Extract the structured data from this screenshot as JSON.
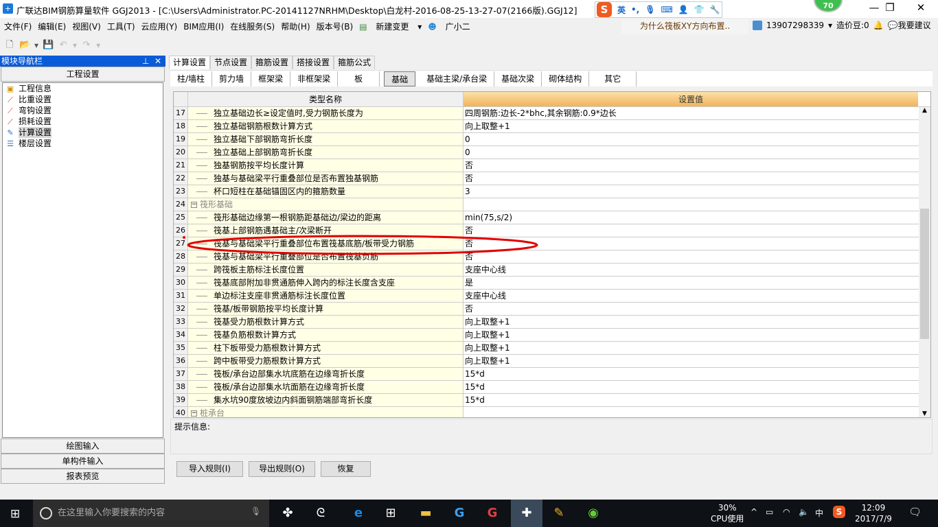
{
  "window": {
    "title": "广联达BIM钢筋算量软件 GGJ2013 - [C:\\Users\\Administrator.PC-20141127NRHM\\Desktop\\白龙村-2016-08-25-13-27-07(2166版).GGJ12]",
    "badge": "70",
    "ime_lang": "英"
  },
  "menu": [
    "文件(F)",
    "编辑(E)",
    "视图(V)",
    "工具(T)",
    "云应用(Y)",
    "BIM应用(I)",
    "在线服务(S)",
    "帮助(H)",
    "版本号(B)",
    "新建变更",
    "广小二"
  ],
  "header": {
    "question": "为什么筏板XY方向布置..",
    "user": "13907298339",
    "beans": "造价豆:0",
    "suggest": "我要建议"
  },
  "left_panel": {
    "title": "模块导航栏",
    "section": "工程设置",
    "tree": [
      "工程信息",
      "比重设置",
      "弯钩设置",
      "损耗设置",
      "计算设置",
      "楼层设置"
    ],
    "selected": "计算设置",
    "bottom": [
      "绘图输入",
      "单构件输入",
      "报表预览"
    ]
  },
  "tabs": [
    "计算设置",
    "节点设置",
    "箍筋设置",
    "搭接设置",
    "箍筋公式"
  ],
  "active_tab": "计算设置",
  "subtabs": [
    "柱/墙柱",
    "剪力墙",
    "框架梁",
    "非框架梁",
    "板",
    "基础",
    "基础主梁/承台梁",
    "基础次梁",
    "砌体结构",
    "其它"
  ],
  "active_subtab": "基础",
  "grid": {
    "col_name": "类型名称",
    "col_value": "设置值",
    "rows": [
      {
        "n": "17",
        "name": "独立基础边长≥设定值时,受力钢筋长度为",
        "value": "四周钢筋:边长-2*bhc,其余钢筋:0.9*边长"
      },
      {
        "n": "18",
        "name": "独立基础钢筋根数计算方式",
        "value": "向上取整+1"
      },
      {
        "n": "19",
        "name": "独立基础下部钢筋弯折长度",
        "value": "0"
      },
      {
        "n": "20",
        "name": "独立基础上部钢筋弯折长度",
        "value": "0"
      },
      {
        "n": "21",
        "name": "独基钢筋按平均长度计算",
        "value": "否"
      },
      {
        "n": "22",
        "name": "独基与基础梁平行重叠部位是否布置独基钢筋",
        "value": "否"
      },
      {
        "n": "23",
        "name": "杯口短柱在基础锚固区内的箍筋数量",
        "value": "3"
      },
      {
        "n": "24",
        "name": "筏形基础",
        "value": "",
        "group": true
      },
      {
        "n": "25",
        "name": "筏形基础边缘第一根钢筋距基础边/梁边的距离",
        "value": "min(75,s/2)"
      },
      {
        "n": "26",
        "name": "筏基上部钢筋遇基础主/次梁断开",
        "value": "否"
      },
      {
        "n": "27",
        "name": "筏基与基础梁平行重叠部位布置筏基底筋/板带受力钢筋",
        "value": "否"
      },
      {
        "n": "28",
        "name": "筏基与基础梁平行重叠部位是否布置筏基负筋",
        "value": "否"
      },
      {
        "n": "29",
        "name": "跨筏板主筋标注长度位置",
        "value": "支座中心线"
      },
      {
        "n": "30",
        "name": "筏基底部附加非贯通筋伸入跨内的标注长度含支座",
        "value": "是"
      },
      {
        "n": "31",
        "name": "单边标注支座非贯通筋标注长度位置",
        "value": "支座中心线"
      },
      {
        "n": "32",
        "name": "筏基/板带钢筋按平均长度计算",
        "value": "否"
      },
      {
        "n": "33",
        "name": "筏基受力筋根数计算方式",
        "value": "向上取整+1"
      },
      {
        "n": "34",
        "name": "筏基负筋根数计算方式",
        "value": "向上取整+1"
      },
      {
        "n": "35",
        "name": "柱下板带受力筋根数计算方式",
        "value": "向上取整+1"
      },
      {
        "n": "36",
        "name": "跨中板带受力筋根数计算方式",
        "value": "向上取整+1"
      },
      {
        "n": "37",
        "name": "筏板/承台边部集水坑底筋在边缘弯折长度",
        "value": "15*d"
      },
      {
        "n": "38",
        "name": "筏板/承台边部集水坑面筋在边缘弯折长度",
        "value": "15*d"
      },
      {
        "n": "39",
        "name": "集水坑90度放坡边内斜面钢筋端部弯折长度",
        "value": "15*d"
      },
      {
        "n": "40",
        "name": "桩承台",
        "value": "",
        "group": true
      }
    ]
  },
  "highlighted_row": "27",
  "hint_label": "提示信息:",
  "buttons": {
    "import": "导入规则(I)",
    "export": "导出规则(O)",
    "restore": "恢复"
  },
  "taskbar": {
    "search_placeholder": "在这里输入你要搜索的内容",
    "cpu": "30%",
    "cpu_label": "CPU使用",
    "ime": "中",
    "time": "12:09",
    "date": "2017/7/9"
  },
  "colors": {
    "nav_header": "#0a5bd8",
    "header_value": "#f1b35b",
    "name_cell": "#ffffe6",
    "annotation": "#e00000"
  }
}
